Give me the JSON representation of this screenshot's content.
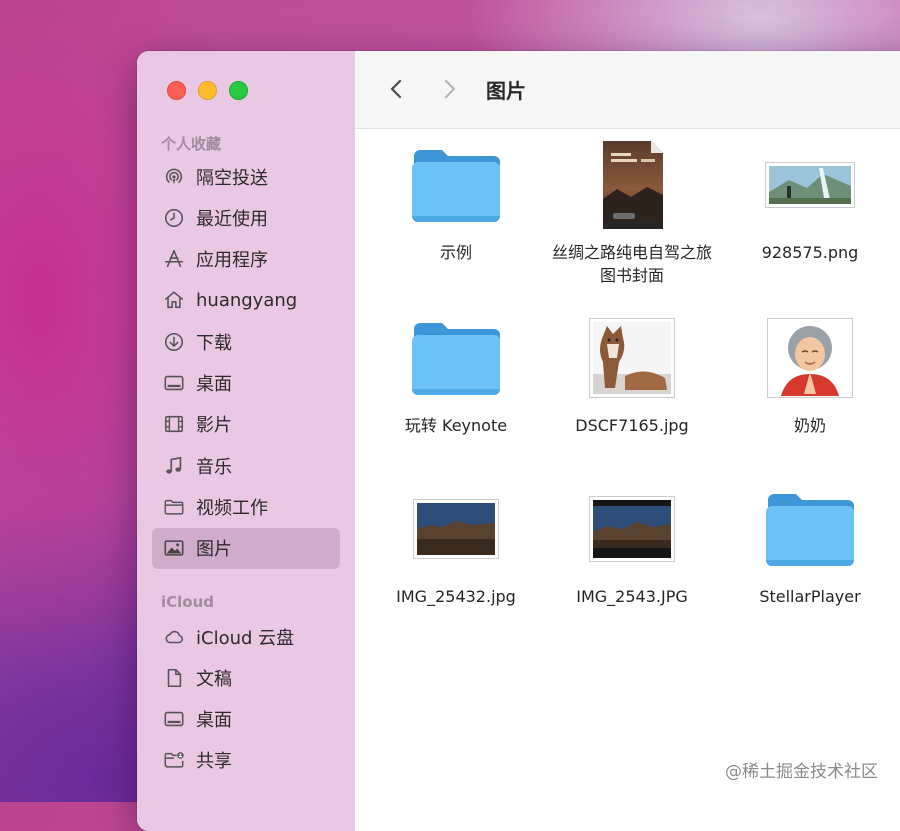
{
  "window": {
    "current_folder": "图片"
  },
  "sidebar": {
    "favorites_title": "个人收藏",
    "favorites": [
      {
        "label": "隔空投送",
        "icon": "airdrop-icon"
      },
      {
        "label": "最近使用",
        "icon": "clock-icon"
      },
      {
        "label": "应用程序",
        "icon": "applications-icon"
      },
      {
        "label": "huangyang",
        "icon": "home-icon"
      },
      {
        "label": "下载",
        "icon": "download-icon"
      },
      {
        "label": "桌面",
        "icon": "desktop-icon"
      },
      {
        "label": "影片",
        "icon": "film-icon"
      },
      {
        "label": "音乐",
        "icon": "music-icon"
      },
      {
        "label": "视频工作",
        "icon": "folder-icon"
      },
      {
        "label": "图片",
        "icon": "pictures-icon",
        "selected": true
      }
    ],
    "icloud_title": "iCloud",
    "icloud": [
      {
        "label": "iCloud 云盘",
        "icon": "cloud-icon"
      },
      {
        "label": "文稿",
        "icon": "document-icon"
      },
      {
        "label": "桌面",
        "icon": "desktop-icon"
      },
      {
        "label": "共享",
        "icon": "shared-folder-icon"
      }
    ]
  },
  "files": [
    {
      "name": "示例",
      "kind": "folder"
    },
    {
      "name": "丝绸之路纯电自驾之旅 图书封面",
      "kind": "book-cover"
    },
    {
      "name": "928575.png",
      "kind": "landscape-image"
    },
    {
      "name": "玩转 Keynote",
      "kind": "folder"
    },
    {
      "name": "DSCF7165.jpg",
      "kind": "cat-photo"
    },
    {
      "name": "奶奶",
      "kind": "memoji-image"
    },
    {
      "name": "IMG_25432.jpg",
      "kind": "desert-photo"
    },
    {
      "name": "IMG_2543.JPG",
      "kind": "desert-photo-dark"
    },
    {
      "name": "StellarPlayer",
      "kind": "folder"
    }
  ],
  "watermark": "@稀土掘金技术社区",
  "colors": {
    "folder_blue": "#5ab6f2",
    "sidebar_bg": "#e8c6e2",
    "selected_bg": "#c9a8c4"
  }
}
